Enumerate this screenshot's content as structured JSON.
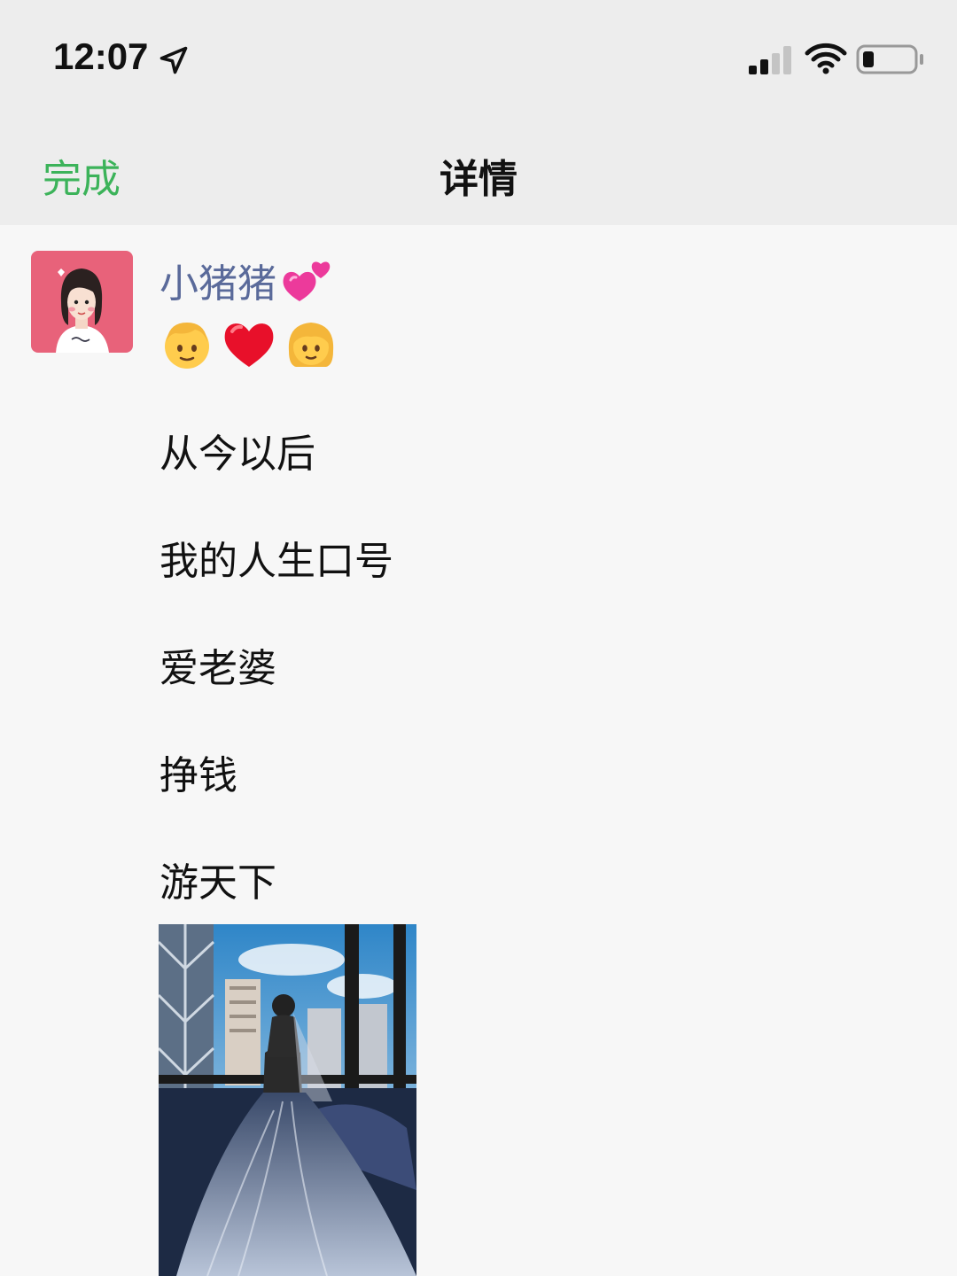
{
  "status_bar": {
    "time": "12:07",
    "icons": [
      "location-arrow-icon",
      "cellular-signal-icon",
      "wifi-icon",
      "battery-icon"
    ]
  },
  "nav": {
    "done_label": "完成",
    "title": "详情"
  },
  "post": {
    "author": "小猪猪",
    "author_icon": "two-hearts-icon",
    "emoji_line": [
      "boy-emoji",
      "red-heart-emoji",
      "girl-emoji"
    ],
    "lines": [
      "从今以后",
      "我的人生口号",
      "爱老婆",
      "挣钱",
      "游天下"
    ],
    "photo": "bride-wedding-dress-photo"
  },
  "colors": {
    "accent_green": "#3cb35a",
    "author_blue": "#5a6a9a",
    "header_bg": "#ededed",
    "page_bg": "#f7f7f7"
  }
}
